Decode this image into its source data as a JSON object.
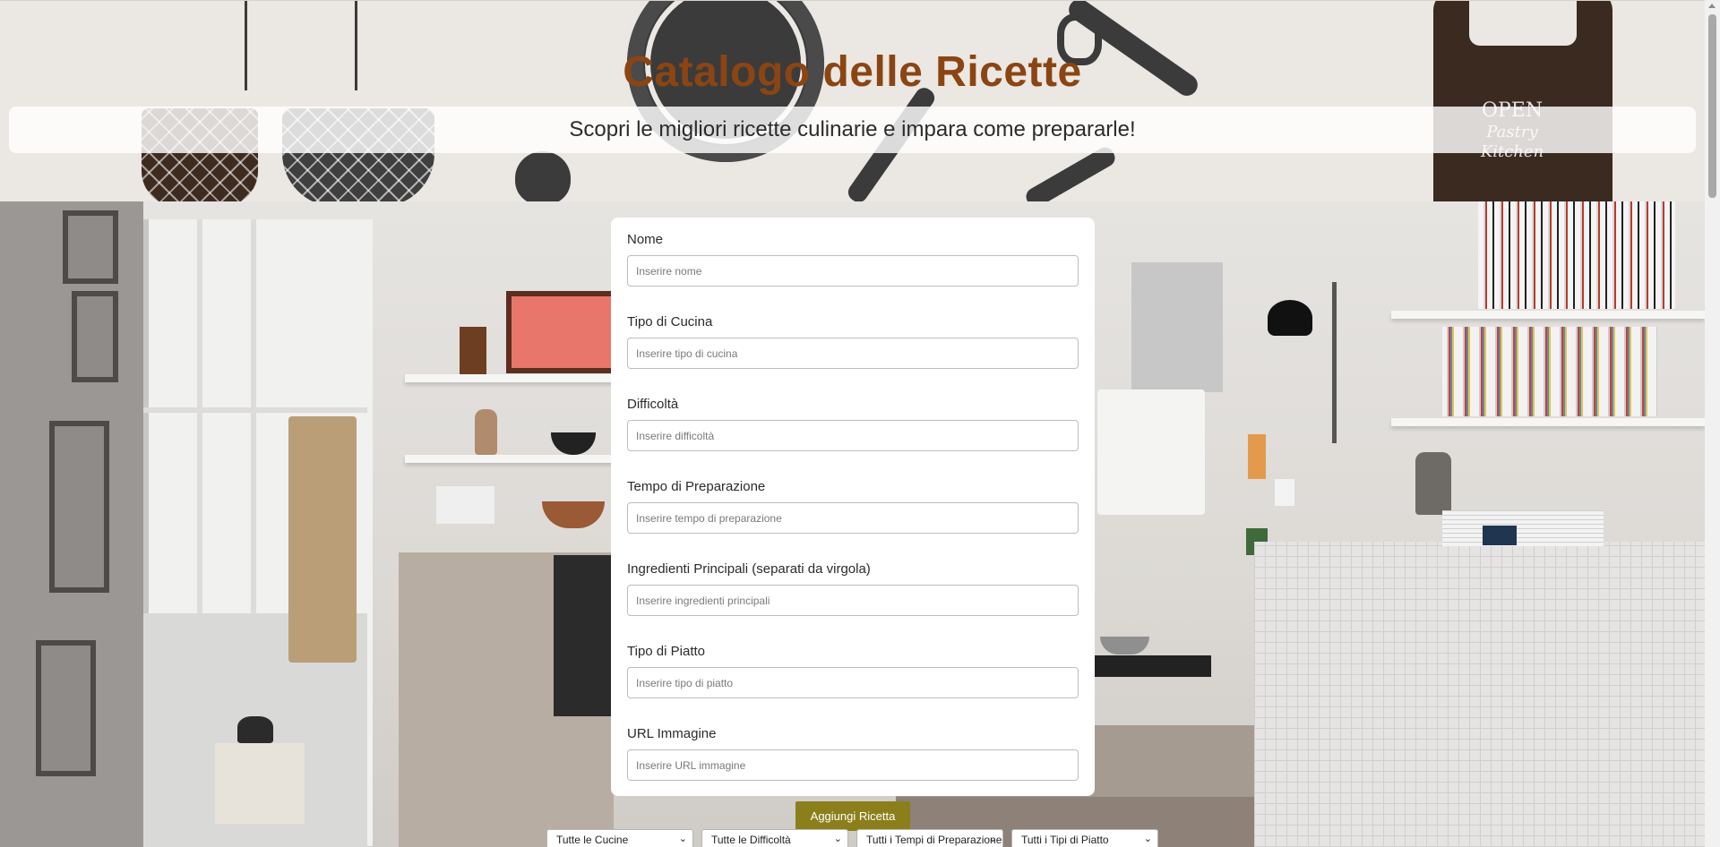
{
  "header": {
    "title": "Catalogo delle Ricette",
    "subtitle": "Scopri le migliori ricette culinarie e impara come prepararle!",
    "logo_text_top": "OPEN",
    "logo_text_bottom": "Pastry Kitchen"
  },
  "form": {
    "fields": [
      {
        "label": "Nome",
        "placeholder": "Inserire nome",
        "value": ""
      },
      {
        "label": "Tipo di Cucina",
        "placeholder": "Inserire tipo di cucina",
        "value": ""
      },
      {
        "label": "Difficoltà",
        "placeholder": "Inserire difficoltà",
        "value": ""
      },
      {
        "label": "Tempo di Preparazione",
        "placeholder": "Inserire tempo di preparazione",
        "value": ""
      },
      {
        "label": "Ingredienti Principali (separati da virgola)",
        "placeholder": "Inserire ingredienti principali",
        "value": ""
      },
      {
        "label": "Tipo di Piatto",
        "placeholder": "Inserire tipo di piatto",
        "value": ""
      },
      {
        "label": "URL Immagine",
        "placeholder": "Inserire URL immagine",
        "value": ""
      }
    ],
    "submit_label": "Aggiungi Ricetta"
  },
  "filters": [
    {
      "selected": "Tutte le Cucine"
    },
    {
      "selected": "Tutte le Difficoltà"
    },
    {
      "selected": "Tutti i Tempi di Preparazione"
    },
    {
      "selected": "Tutti i Tipi di Piatto"
    }
  ],
  "colors": {
    "title": "#8b4513",
    "button": "#8b7f1c",
    "header_bg": "#ebe7e3"
  },
  "icons": {
    "dropdown": "chevron-down-icon"
  }
}
